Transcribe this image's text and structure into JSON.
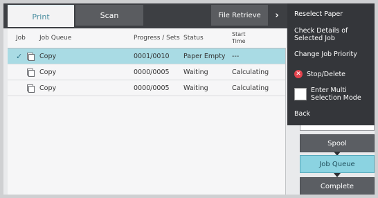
{
  "tabs": {
    "print": "Print",
    "scan": "Scan",
    "file_retrieve": "File Retrieve"
  },
  "table": {
    "headers": {
      "job": "Job",
      "queue": "Job Queue",
      "progress": "Progress / Sets",
      "status": "Status",
      "start": "Start Time"
    },
    "rows": [
      {
        "check": "✓",
        "queue": "Copy",
        "progress": "0001/0010",
        "status": "Paper Empty",
        "start": "---",
        "selected": true
      },
      {
        "check": "",
        "queue": "Copy",
        "progress": "0000/0005",
        "status": "Waiting",
        "start": "Calculating",
        "selected": false
      },
      {
        "check": "",
        "queue": "Copy",
        "progress": "0000/0005",
        "status": "Waiting",
        "start": "Calculating",
        "selected": false
      }
    ]
  },
  "menu": {
    "reselect_paper": "Reselect Paper",
    "check_details": "Check Details of Selected Job",
    "change_priority": "Change Job Priority",
    "stop_delete": "Stop/Delete",
    "multi_select": "Enter Multi Selection Mode",
    "back": "Back"
  },
  "side_buttons": {
    "spool": "Spool",
    "job_queue": "Job Queue",
    "complete": "Complete"
  },
  "icons": {
    "tab_arrow": "chevron-right-icon",
    "stop": "close-circle-icon",
    "job": "copy-document-icon"
  },
  "colors": {
    "accent": "#8bd3e1",
    "selected_row": "#a9dbe4",
    "stop_red": "#e4434d",
    "menu_bg": "#34363a"
  }
}
